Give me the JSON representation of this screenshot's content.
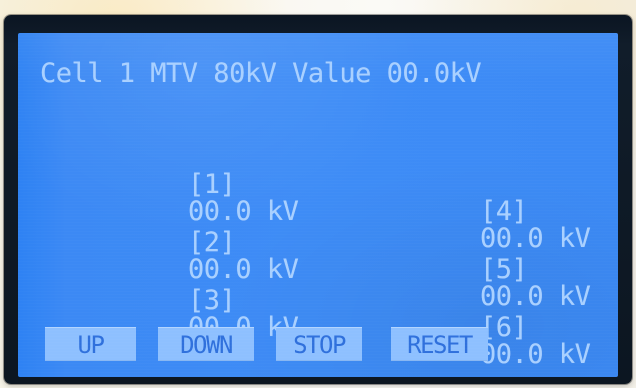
{
  "display": {
    "header": "Cell 1 MTV 80kV Value 00.0kV",
    "readings": [
      {
        "index_label": "[1]",
        "value": "00.0 kV"
      },
      {
        "index_label": "[4]",
        "value": "00.0 kV"
      },
      {
        "index_label": "[2]",
        "value": "00.0 kV"
      },
      {
        "index_label": "[5]",
        "value": "00.0 kV"
      },
      {
        "index_label": "[3]",
        "value": "00.0 kV"
      },
      {
        "index_label": "[6]",
        "value": "00.0 kV"
      }
    ],
    "buttons": {
      "up": "UP",
      "down": "DOWN",
      "stop": "STOP",
      "reset": "RESET"
    }
  },
  "colors": {
    "screen": "#3e8cf6",
    "text": "#a9d0ff",
    "button_fill": "#8ec0ff",
    "button_text": "#2f70dc"
  }
}
